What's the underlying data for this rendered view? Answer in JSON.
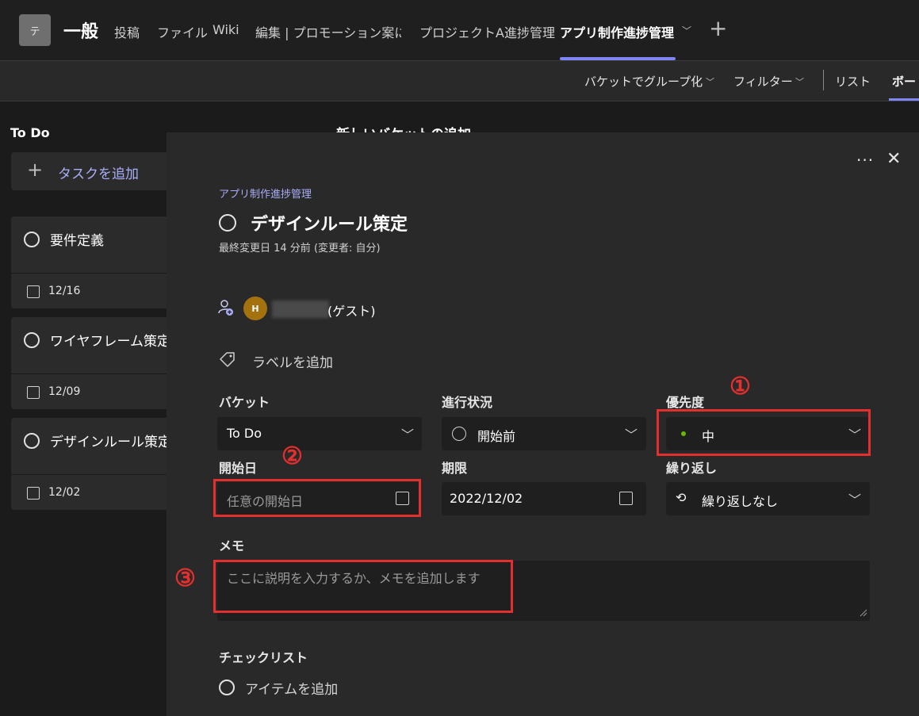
{
  "team": {
    "avatar_letter": "テ",
    "channel_name": "一般"
  },
  "tabs": [
    {
      "label": "投稿"
    },
    {
      "label": "ファイル"
    },
    {
      "label": "Wiki"
    },
    {
      "label": "編集 | プロモーション案に..."
    },
    {
      "label": "プロジェクトA進捗管理"
    },
    {
      "label": "アプリ制作進捗管理",
      "active": true
    }
  ],
  "toolbar": {
    "group_by": "バケットでグループ化",
    "filter": "フィルター",
    "list": "リスト",
    "board": "ボード"
  },
  "board": {
    "column_title": "To Do",
    "add_task": "タスクを追加",
    "new_bucket": "新しいバケットの追加",
    "cards": [
      {
        "title": "要件定義",
        "date": "12/16"
      },
      {
        "title": "ワイヤフレーム策定",
        "date": "12/09"
      },
      {
        "title": "デザインルール策定",
        "date": "12/02"
      }
    ]
  },
  "task": {
    "plan_name": "アプリ制作進捗管理",
    "title": "デザインルール策定",
    "modified": "最終変更日 14 分前 (変更者: 自分)",
    "assignee_initial": "H",
    "assignee_suffix": "(ゲスト)",
    "add_label": "ラベルを追加",
    "bucket_label": "バケット",
    "bucket_value": "To Do",
    "progress_label": "進行状況",
    "progress_value": "開始前",
    "priority_label": "優先度",
    "priority_value": "中",
    "start_label": "開始日",
    "start_placeholder": "任意の開始日",
    "due_label": "期限",
    "due_value": "2022/12/02",
    "repeat_label": "繰り返し",
    "repeat_value": "繰り返しなし",
    "memo_label": "メモ",
    "memo_placeholder": "ここに説明を入力するか、メモを追加します",
    "checklist_label": "チェックリスト",
    "add_item": "アイテムを追加"
  },
  "annotations": {
    "one": "①",
    "two": "②",
    "three": "③"
  },
  "colors": {
    "accent": "#7f85f5",
    "highlight": "#e3302f",
    "priority_dot": "#6bb700"
  }
}
